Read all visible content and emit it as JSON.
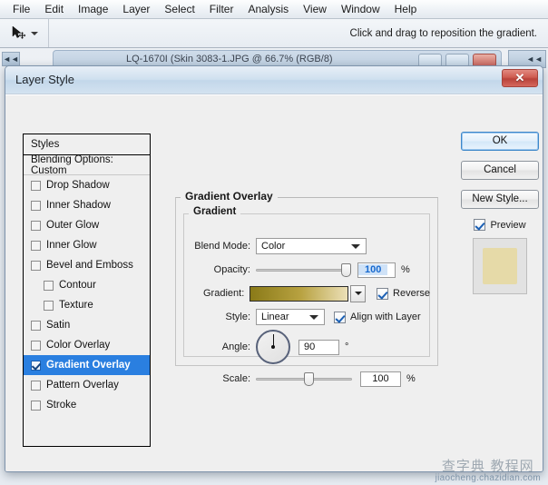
{
  "menubar": {
    "items": [
      {
        "label": "File"
      },
      {
        "label": "Edit"
      },
      {
        "label": "Image"
      },
      {
        "label": "Layer"
      },
      {
        "label": "Select"
      },
      {
        "label": "Filter"
      },
      {
        "label": "Analysis"
      },
      {
        "label": "View"
      },
      {
        "label": "Window"
      },
      {
        "label": "Help"
      }
    ]
  },
  "options_bar": {
    "tool_icon": "move-tool-icon",
    "hint": "Click and drag to reposition the gradient."
  },
  "doc_window": {
    "title": "LQ-1670I (Skin 3083-1.JPG @ 66.7% (RGB/8)",
    "minimize_label": "",
    "maximize_label": "",
    "close_label": "",
    "left_nub": "◄◄",
    "right_nub": "◄◄"
  },
  "dialog": {
    "title": "Layer Style",
    "close_label": "✕"
  },
  "styles_panel": {
    "header": "Styles",
    "blending_options": "Blending Options: Custom",
    "effects": [
      {
        "label": "Drop Shadow",
        "checked": false,
        "indent": false,
        "selected": false
      },
      {
        "label": "Inner Shadow",
        "checked": false,
        "indent": false,
        "selected": false
      },
      {
        "label": "Outer Glow",
        "checked": false,
        "indent": false,
        "selected": false
      },
      {
        "label": "Inner Glow",
        "checked": false,
        "indent": false,
        "selected": false
      },
      {
        "label": "Bevel and Emboss",
        "checked": false,
        "indent": false,
        "selected": false
      },
      {
        "label": "Contour",
        "checked": false,
        "indent": true,
        "selected": false
      },
      {
        "label": "Texture",
        "checked": false,
        "indent": true,
        "selected": false
      },
      {
        "label": "Satin",
        "checked": false,
        "indent": false,
        "selected": false
      },
      {
        "label": "Color Overlay",
        "checked": false,
        "indent": false,
        "selected": false
      },
      {
        "label": "Gradient Overlay",
        "checked": true,
        "indent": false,
        "selected": true
      },
      {
        "label": "Pattern Overlay",
        "checked": false,
        "indent": false,
        "selected": false
      },
      {
        "label": "Stroke",
        "checked": false,
        "indent": false,
        "selected": false
      }
    ]
  },
  "gradient_overlay": {
    "group_title": "Gradient Overlay",
    "inner_title": "Gradient",
    "blend_mode": {
      "label": "Blend Mode:",
      "value": "Color"
    },
    "opacity": {
      "label": "Opacity:",
      "value": "100",
      "unit": "%"
    },
    "gradient": {
      "label": "Gradient:",
      "start_color": "#8a7a18",
      "mid_color": "#b8a241",
      "end_color": "#ece0b8",
      "reverse_label": "Reverse",
      "reverse_checked": true
    },
    "style": {
      "label": "Style:",
      "value": "Linear",
      "align_label": "Align with Layer",
      "align_checked": true
    },
    "angle": {
      "label": "Angle:",
      "value": "90",
      "unit": "°"
    },
    "scale": {
      "label": "Scale:",
      "value": "100",
      "unit": "%"
    }
  },
  "buttons": {
    "ok": "OK",
    "cancel": "Cancel",
    "new_style": "New Style...",
    "preview_label": "Preview",
    "preview_checked": true,
    "preview_chip_color": "#e6daa8"
  },
  "watermark": {
    "line1": "查字典 教程网",
    "line2": "jiaocheng.chazidian.com"
  }
}
